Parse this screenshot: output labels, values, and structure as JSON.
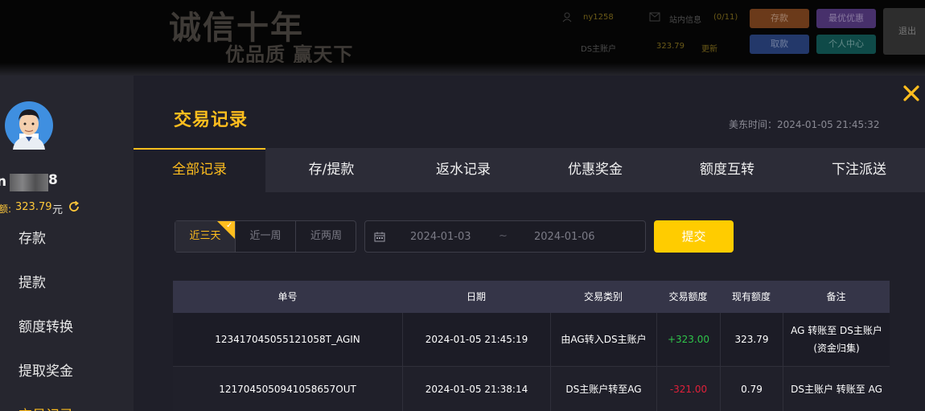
{
  "header": {
    "logo_main": "诚信十年",
    "logo_sub": "优品质 赢天下",
    "username": "ny1258",
    "mail_label": "站内信息",
    "mail_count": "(0/11)",
    "account_label": "DS主账户",
    "account_value": "323.79",
    "refresh_label": "更新",
    "btn_deposit": "存款",
    "btn_promo": "最优优惠",
    "btn_withdraw": "取款",
    "btn_center": "个人中心",
    "btn_logout": "退出"
  },
  "sidebar": {
    "username_start": "n",
    "username_end": "8",
    "balance_prefix": "额:",
    "balance_value": "323.79",
    "balance_unit": "元",
    "items": [
      {
        "label": "存款"
      },
      {
        "label": "提款"
      },
      {
        "label": "额度转换"
      },
      {
        "label": "提取奖金"
      },
      {
        "label": "交易记录"
      }
    ]
  },
  "modal": {
    "title": "交易记录",
    "time_label": "美东时间：2024-01-05 21:45:32",
    "tabs": [
      {
        "label": "全部记录"
      },
      {
        "label": "存/提款"
      },
      {
        "label": "返水记录"
      },
      {
        "label": "优惠奖金"
      },
      {
        "label": "额度互转"
      },
      {
        "label": "下注派送"
      }
    ],
    "range_options": [
      {
        "label": "近三天"
      },
      {
        "label": "近一周"
      },
      {
        "label": "近两周"
      }
    ],
    "date_from": "2024-01-03",
    "date_sep": "~",
    "date_to": "2024-01-06",
    "submit_label": "提交"
  },
  "table": {
    "headers": [
      "单号",
      "日期",
      "交易类别",
      "交易额度",
      "现有额度",
      "备注"
    ],
    "rows": [
      {
        "id": "12341704505512105​8T_AGIN",
        "date": "2024-01-05 21:45:19",
        "type": "由AG转入DS主账户",
        "amount": "+323.00",
        "balance": "323.79",
        "note": "AG 转账至 DS主账户(资金归集)"
      },
      {
        "id": "1217045050941058657OUT",
        "date": "2024-01-05 21:38:14",
        "type": "DS主账户转至AG",
        "amount": "-321.00",
        "balance": "0.79",
        "note": "DS主账户 转账至 AG"
      }
    ]
  },
  "colors": {
    "accent": "#ffbe1e",
    "positive": "#2fc44a",
    "negative": "#e0203a"
  }
}
